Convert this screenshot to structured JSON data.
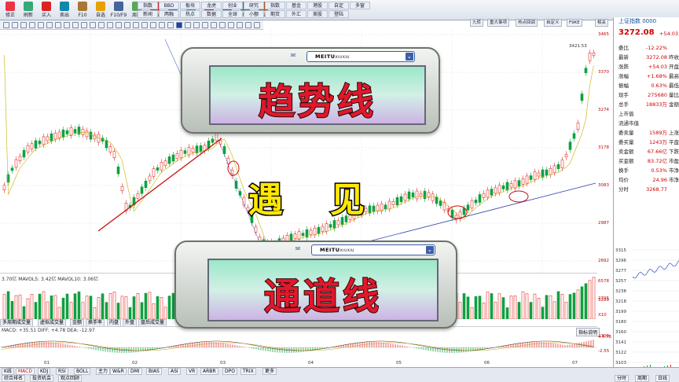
{
  "toolbar": {
    "buttons": [
      "修正",
      "刷新",
      "买入",
      "卖出",
      "F10",
      "自选",
      "F10/F9",
      "周期",
      "画线",
      "论股",
      "选股",
      "指标",
      "个股",
      "研报",
      "资讯"
    ],
    "grid_items": [
      "指数",
      "新闻",
      "BBD",
      "两融",
      "板块",
      "热点",
      "龙虎",
      "数据",
      "创业",
      "全球",
      "研究",
      "小额",
      "指数",
      "期货",
      "基金",
      "外汇",
      "港股",
      "美股",
      "自定",
      "登陆",
      "多窗"
    ]
  },
  "tabs": [
    "九转",
    "重大事项",
    "热点回调",
    "自定义",
    "F9KE",
    "相关"
  ],
  "info": {
    "header": "上证指数 0000",
    "price": "3272.08",
    "change_pct_header": "+54.03",
    "rows": [
      {
        "k": "委比",
        "v": "-12.22%",
        "k2": ""
      },
      {
        "k": "最新",
        "v": "3272.08",
        "k2": "昨收"
      },
      {
        "k": "涨跌",
        "v": "+54.03",
        "k2": "开盘"
      },
      {
        "k": "涨幅",
        "v": "+1.68%",
        "k2": "最高"
      },
      {
        "k": "振幅",
        "v": "0.63%",
        "k2": "最低"
      },
      {
        "k": "现手",
        "v": "275680",
        "k2": "量比"
      },
      {
        "k": "总手",
        "v": "18833万",
        "k2": "金额"
      },
      {
        "k": "上市值",
        "v": "",
        "k2": ""
      },
      {
        "k": "流通市值",
        "v": "",
        "k2": ""
      },
      {
        "k": "委卖量",
        "v": "1589万",
        "k2": "上涨"
      },
      {
        "k": "委买量",
        "v": "1243万",
        "k2": "平盘"
      },
      {
        "k": "卖金额",
        "v": "67.66亿",
        "k2": "下跌"
      },
      {
        "k": "买金额",
        "v": "83.72亿",
        "k2": "市盈"
      },
      {
        "k": "换手",
        "v": "0.53%",
        "k2": "市净"
      },
      {
        "k": "均价",
        "v": "24.96",
        "k2": "市净"
      },
      {
        "k": "分时",
        "v": "3268.77",
        "k2": ""
      }
    ],
    "mini_axis": [
      "3315",
      "3296",
      "3277",
      "3257",
      "3238",
      "3218",
      "3199",
      "3180",
      "3160",
      "3141",
      "3122",
      "3103"
    ]
  },
  "price_axis": [
    "3465",
    "3370",
    "3274",
    "3178",
    "3083",
    "2987",
    "2892",
    "2795",
    "2700"
  ],
  "high_label": "3421.53",
  "volume": {
    "label": "3.70亿  MAVOL5: 3.42亿  MAVOL10: 3.06亿",
    "axis": [
      "6578",
      "3289"
    ],
    "unit": "X10"
  },
  "subtabs": [
    "多周期成交量",
    "虚拟成交量",
    "金额",
    "换手率",
    "内盘",
    "外盘",
    "盘后成交量"
  ],
  "macd": {
    "label": "MACD: +35.51  DIFF: +4.78  DEA: -12.97",
    "axis": [
      "+4.78",
      "-2.55"
    ],
    "button": "指标说明"
  },
  "months": [
    "01",
    "02",
    "03",
    "04",
    "05",
    "06",
    "07"
  ],
  "bottom_tabs": [
    "K线",
    "MACD",
    "KDJ",
    "RSI",
    "BOLL",
    "主力",
    "W&R",
    "DMI",
    "BIAS",
    "ASI",
    "VR",
    "ARBR",
    "DPO",
    "TRIX",
    "更多"
  ],
  "bottom_tabs2": [
    "综合排名",
    "投资机会",
    "观点回顾"
  ],
  "bottom_right": [
    "分时",
    "周期",
    "日线"
  ],
  "overlay_top": {
    "window_title": "MEITU",
    "window_sub": "XIUXIU",
    "text": "趋势线"
  },
  "overlay_mid": {
    "text1": "遇",
    "text2": "见"
  },
  "overlay_bottom": {
    "window_title": "MEITU",
    "window_sub": "XIUXIU",
    "text": "通道线"
  },
  "colors": {
    "up": "#e4322b",
    "down": "#10a040",
    "trend": "#cc1010",
    "channel": "#3040b0",
    "ma": "#c8b000"
  }
}
